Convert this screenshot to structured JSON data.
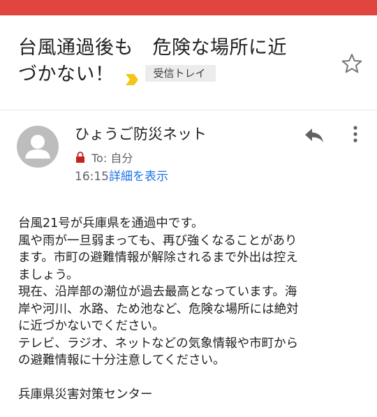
{
  "status_bar": {
    "color": "#e0463f"
  },
  "subject": {
    "line1": "台風通過後も　危険な場所に近",
    "line2": "づかない！",
    "importance_marker_icon": "importance-marker-icon",
    "importance_color": "#f5c518",
    "label": "受信トレイ",
    "star_icon": "star-outline-icon"
  },
  "message": {
    "sender": "ひょうご防災ネット",
    "avatar_icon": "default-avatar-icon",
    "recipient_icon": "lock-icon",
    "recipient": "To: 自分",
    "time": "16:15",
    "details_link": "詳細を表示",
    "reply_icon": "reply-icon",
    "more_icon": "more-vert-icon",
    "link_color": "#1a73e8",
    "body_lines": [
      "台風21号が兵庫県を通過中です。",
      "風や雨が一旦弱まっても、再び強くなることがあり",
      "ます。市町の避難情報が解除されるまで外出は控え",
      "ましょう。",
      "現在、沿岸部の潮位が過去最高となっています。海",
      "岸や河川、水路、ため池など、危険な場所には絶対",
      "に近づかないでください。",
      "テレビ、ラジオ、ネットなどの気象情報や市町から",
      "の避難情報に十分注意してください。",
      "",
      "兵庫県災害対策センター"
    ]
  }
}
